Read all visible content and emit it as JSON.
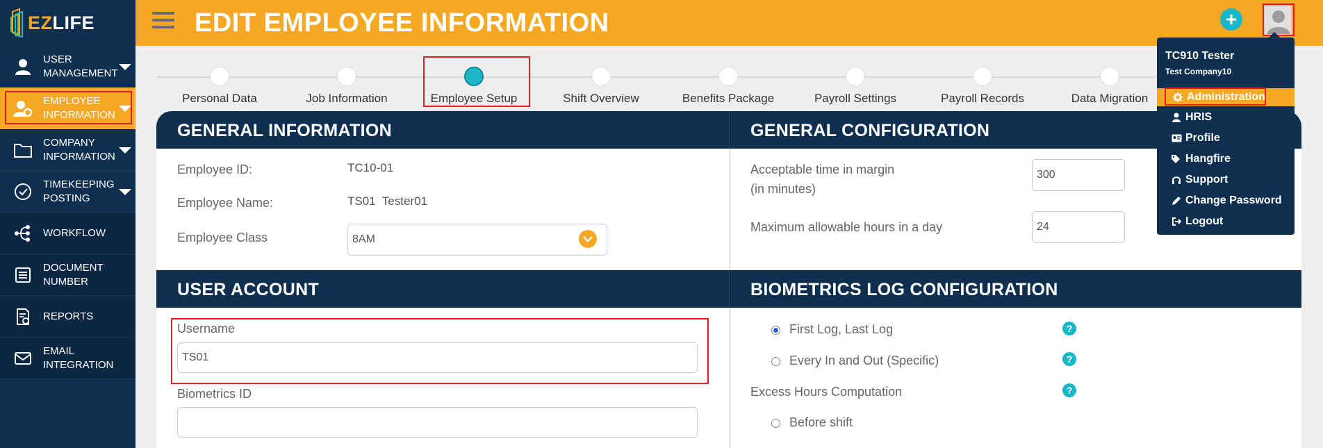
{
  "app": {
    "logo_ez": "EZ",
    "logo_life": "LIFE"
  },
  "sidebar": {
    "items": [
      {
        "label": "USER MANAGEMENT",
        "icon": "user-icon"
      },
      {
        "label": "EMPLOYEE INFORMATION",
        "icon": "user-gear-icon"
      },
      {
        "label": "COMPANY INFORMATION",
        "icon": "folder-icon"
      },
      {
        "label": "TIMEKEEPING POSTING",
        "icon": "check-circle-icon"
      },
      {
        "label": "WORKFLOW",
        "icon": "workflow-icon"
      },
      {
        "label": "DOCUMENT NUMBER",
        "icon": "document-list-icon"
      },
      {
        "label": "REPORTS",
        "icon": "report-icon"
      },
      {
        "label": "EMAIL INTEGRATION",
        "icon": "envelope-icon"
      }
    ]
  },
  "header": {
    "title": "EDIT EMPLOYEE INFORMATION",
    "add_symbol": "+"
  },
  "steps": [
    {
      "label": "Personal Data"
    },
    {
      "label": "Job Information"
    },
    {
      "label": "Employee Setup"
    },
    {
      "label": "Shift Overview"
    },
    {
      "label": "Benefits Package"
    },
    {
      "label": "Payroll Settings"
    },
    {
      "label": "Payroll Records"
    },
    {
      "label": "Data Migration"
    }
  ],
  "general_info": {
    "title": "GENERAL INFORMATION",
    "employee_id_label": "Employee ID:",
    "employee_id": "TC10-01",
    "employee_name_label": "Employee Name:",
    "employee_name": "TS01  Tester01",
    "employee_class_label": "Employee Class",
    "employee_class": "8AM"
  },
  "general_config": {
    "title": "GENERAL CONFIGURATION",
    "margin_label_1": "Acceptable time in margin",
    "margin_label_2": "(in minutes)",
    "margin_value": "300",
    "max_hours_label": "Maximum allowable hours in a day",
    "max_hours_value": "24"
  },
  "user_account": {
    "title": "USER ACCOUNT",
    "username_label": "Username",
    "username_value": "TS01",
    "biometrics_label": "Biometrics ID",
    "biometrics_value": ""
  },
  "biometrics_config": {
    "title": "BIOMETRICS LOG CONFIGURATION",
    "option_1": "First Log, Last Log",
    "option_2": "Every In and Out (Specific)",
    "excess_label": "Excess Hours Computation",
    "option_before": "Before shift",
    "help_symbol": "?"
  },
  "user_menu": {
    "name": "TC910 Tester",
    "company": "Test Company10",
    "items": [
      {
        "label": "Administration",
        "icon": "gear-icon"
      },
      {
        "label": "HRIS",
        "icon": "user-icon"
      },
      {
        "label": "Profile",
        "icon": "id-card-icon"
      },
      {
        "label": "Hangfire",
        "icon": "tags-icon"
      },
      {
        "label": "Support",
        "icon": "headset-icon"
      },
      {
        "label": "Change Password",
        "icon": "pencil-icon"
      },
      {
        "label": "Logout",
        "icon": "logout-icon"
      }
    ]
  },
  "colors": {
    "accent": "#f5a823",
    "navy": "#0e2f4f",
    "teal": "#1ab7c8",
    "highlight_red": "#e51c23"
  }
}
